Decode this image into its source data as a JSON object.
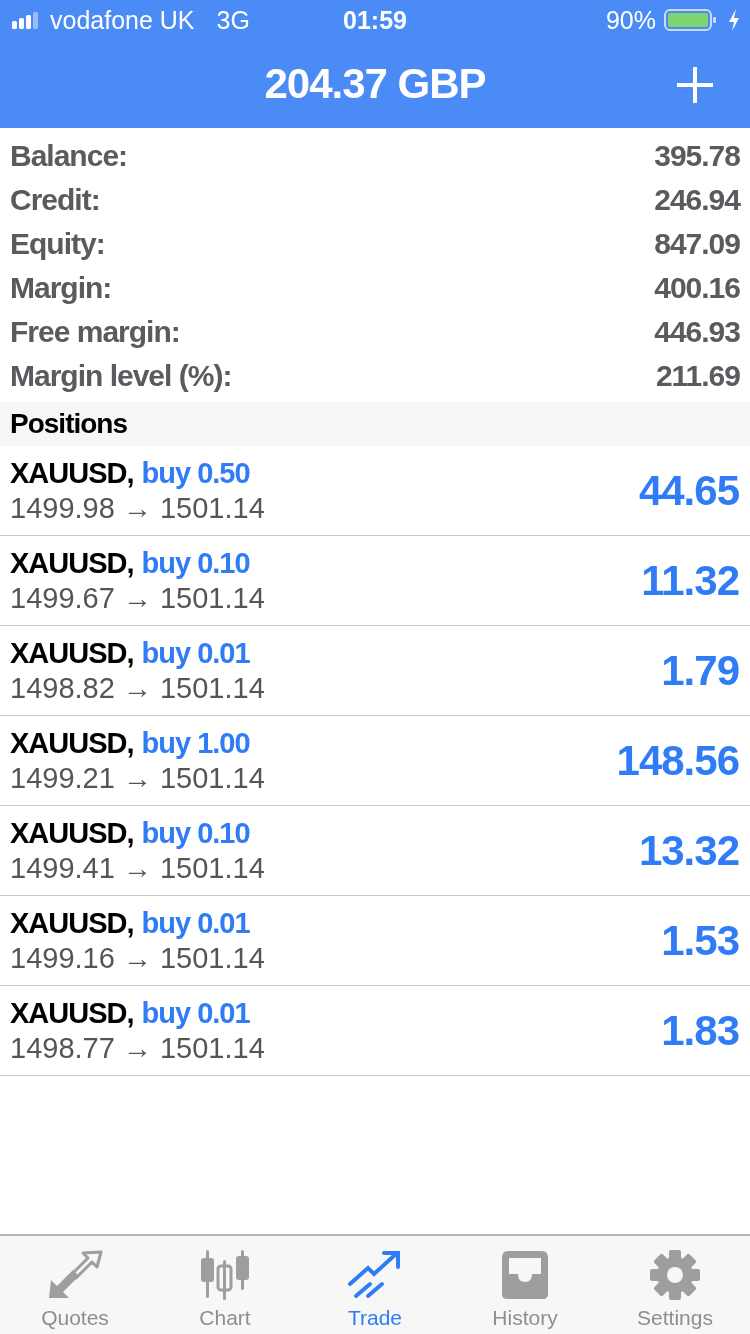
{
  "status_bar": {
    "carrier": "vodafone UK",
    "network": "3G",
    "time": "01:59",
    "battery": "90%"
  },
  "header": {
    "title": "204.37 GBP"
  },
  "summary": [
    {
      "label": "Balance:",
      "value": "395.78"
    },
    {
      "label": "Credit:",
      "value": "246.94"
    },
    {
      "label": "Equity:",
      "value": "847.09"
    },
    {
      "label": "Margin:",
      "value": "400.16"
    },
    {
      "label": "Free margin:",
      "value": "446.93"
    },
    {
      "label": "Margin level (%):",
      "value": "211.69"
    }
  ],
  "positions": {
    "title": "Positions",
    "rows": [
      {
        "symbol": "XAUUSD,",
        "side": "buy 0.50",
        "prices": "1499.98 → 1501.14",
        "profit": "44.65"
      },
      {
        "symbol": "XAUUSD,",
        "side": "buy 0.10",
        "prices": "1499.67 → 1501.14",
        "profit": "11.32"
      },
      {
        "symbol": "XAUUSD,",
        "side": "buy 0.01",
        "prices": "1498.82 → 1501.14",
        "profit": "1.79"
      },
      {
        "symbol": "XAUUSD,",
        "side": "buy 1.00",
        "prices": "1499.21 → 1501.14",
        "profit": "148.56"
      },
      {
        "symbol": "XAUUSD,",
        "side": "buy 0.10",
        "prices": "1499.41 → 1501.14",
        "profit": "13.32"
      },
      {
        "symbol": "XAUUSD,",
        "side": "buy 0.01",
        "prices": "1499.16 → 1501.14",
        "profit": "1.53"
      },
      {
        "symbol": "XAUUSD,",
        "side": "buy 0.01",
        "prices": "1498.77 → 1501.14",
        "profit": "1.83"
      }
    ]
  },
  "tabs": [
    {
      "label": "Quotes",
      "selected": false
    },
    {
      "label": "Chart",
      "selected": false
    },
    {
      "label": "Trade",
      "selected": true
    },
    {
      "label": "History",
      "selected": false
    },
    {
      "label": "Settings",
      "selected": false
    }
  ]
}
